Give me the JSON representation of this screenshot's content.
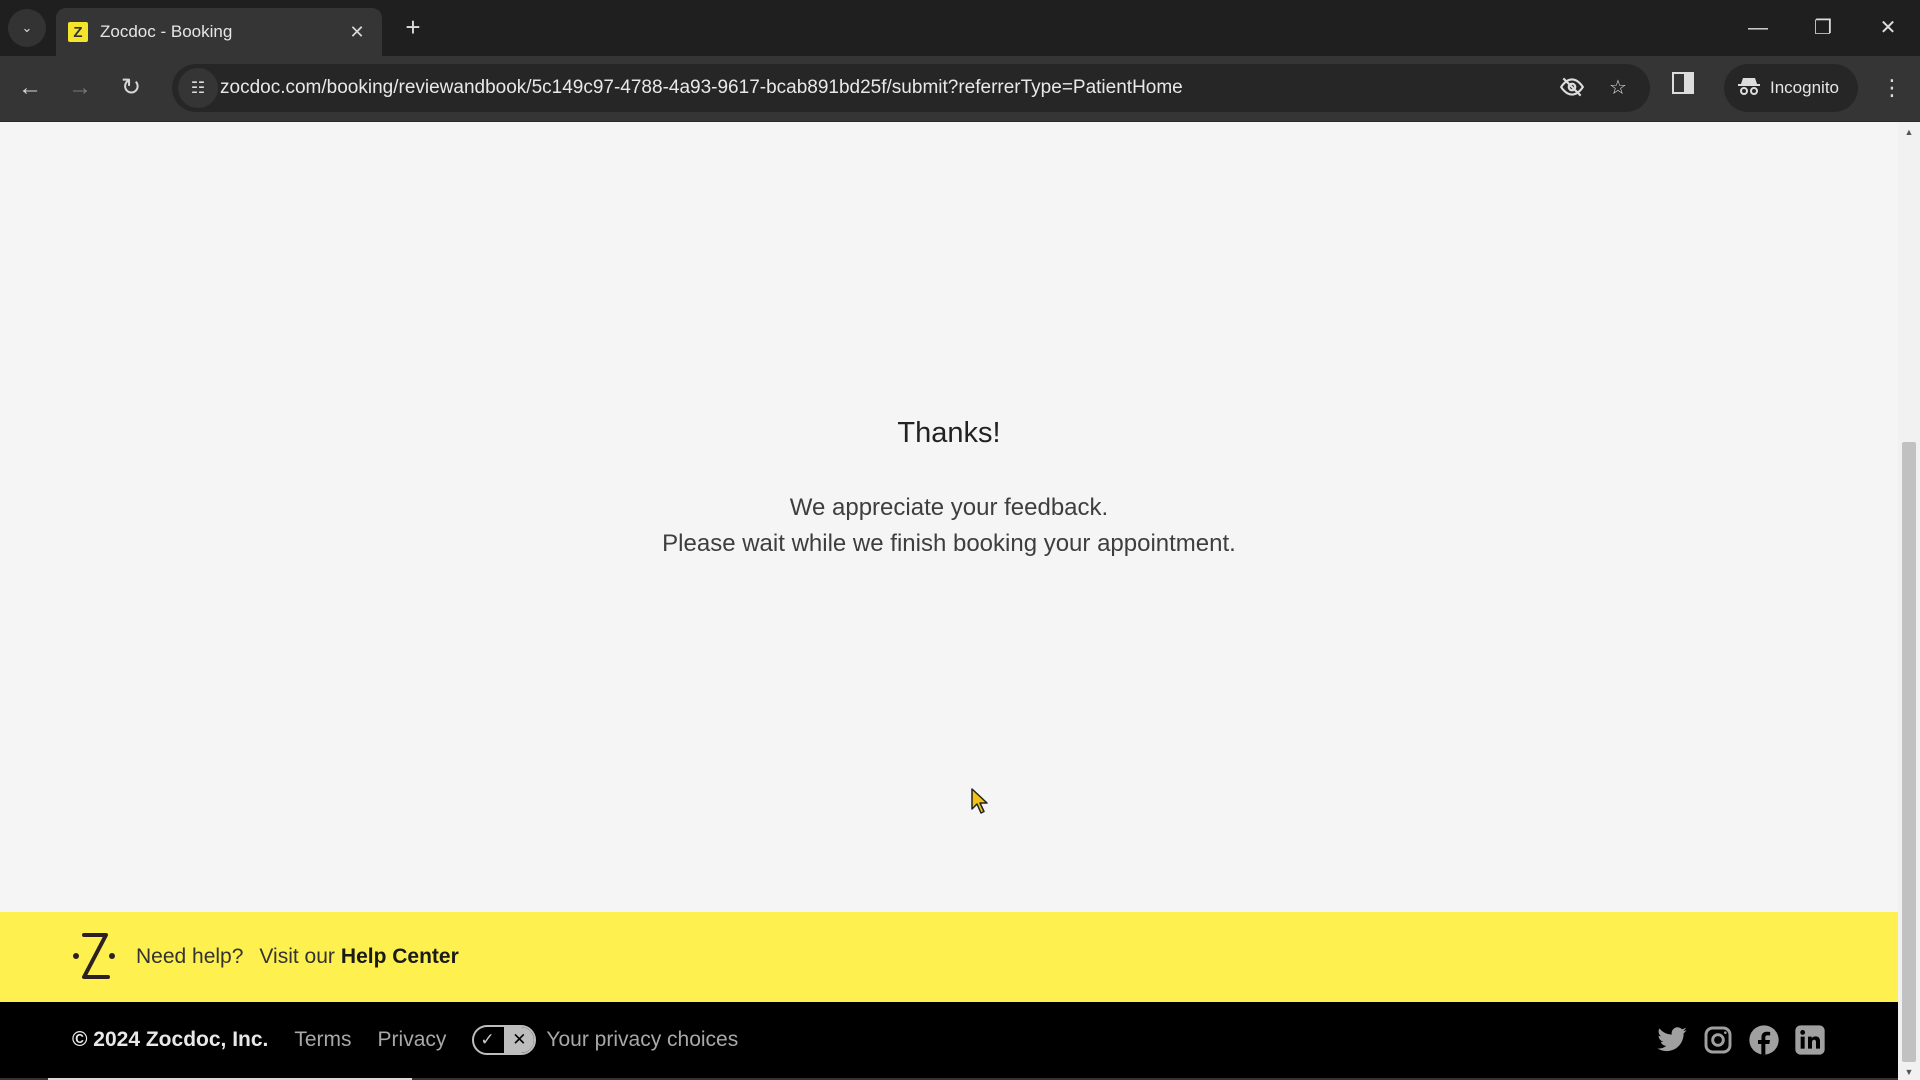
{
  "browser": {
    "tab": {
      "favicon_letter": "Z",
      "title": "Zocdoc - Booking",
      "close_glyph": "✕"
    },
    "new_tab_glyph": "+",
    "tab_search_glyph": "⌄",
    "window_controls": {
      "minimize": "—",
      "restore": "❐",
      "close": "✕"
    },
    "nav": {
      "back": "←",
      "forward": "→",
      "reload": "↻"
    },
    "url": "zocdoc.com/booking/reviewandbook/5c149c97-4788-4a93-9617-bcab891bd25f/submit?referrerType=PatientHome",
    "site_info_glyph": "☷",
    "omnibox_icons": {
      "tracking_protection": "◉",
      "bookmark": "☆"
    },
    "incognito_label": "Incognito",
    "menu_glyph": "⋮"
  },
  "page": {
    "title": "Thanks!",
    "message_line1": "We appreciate your feedback.",
    "message_line2": "Please wait while we finish booking your appointment."
  },
  "help_bar": {
    "need_help": "Need help?",
    "visit_our": "Visit our",
    "help_center_link": "Help Center",
    "brand_color": "#fef04e"
  },
  "footer": {
    "copyright": "© 2024 Zocdoc, Inc.",
    "terms": "Terms",
    "privacy": "Privacy",
    "privacy_choices": "Your privacy choices",
    "toggle_on_glyph": "✓",
    "toggle_off_glyph": "✕",
    "socials": [
      "twitter",
      "instagram",
      "facebook",
      "linkedin"
    ]
  },
  "scrollbar": {
    "up_glyph": "▲",
    "down_glyph": "▼"
  }
}
